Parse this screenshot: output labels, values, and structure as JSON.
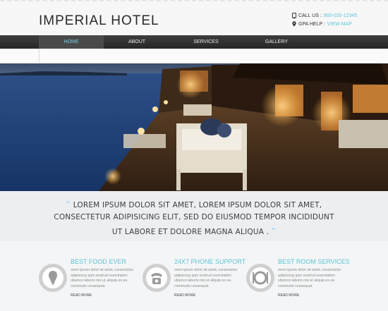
{
  "header": {
    "logo": "IMPERIAL HOTEL",
    "call_label": "CALL US :",
    "call_value": "800-020-12345",
    "gps_label": "GPA HELP :",
    "gps_value": "VIEW MAP"
  },
  "nav": {
    "items": [
      "HOME",
      "ABOUT",
      "SERVICES",
      "GALLERY"
    ],
    "active": "HOME"
  },
  "quote": {
    "open": "“",
    "line1": "LOREM IPSUM DOLOR SIT AMET, LOREM IPSUM DOLOR SIT AMET,",
    "line2": "CONSECTETUR ADIPISICING ELIT, SED DO EIUSMOD TEMPOR INCIDIDUNT",
    "line3": "UT LABORE ET DOLORE MAGNA ALIQUA .",
    "close": "”"
  },
  "features": [
    {
      "title": "BEST FOOD EVER",
      "icon": "ice-cream-icon",
      "text": "orem ipsum dolor sit amet, consectetur adipiscing quis nostrud exercitation ullamco laboris nisi ut aliquip ex ea commodo consequat.",
      "more": "READ MORE"
    },
    {
      "title": "24X7 PHONE SUPPORT",
      "icon": "phone-icon",
      "text": "orem ipsum dolor sit amet, consectetur adipiscing quis nostrud exercitation ullamco laboris nisi ut aliquip ex ea commodo consequat.",
      "more": "READ MORE"
    },
    {
      "title": "BEST ROOM SERVICES",
      "icon": "dining-icon",
      "text": "orem ipsum dolor sit amet, consectetur adipiscing quis nostrud exercitation ullamco laboris nisi ut aliquip ex ea commodo consequat.",
      "more": "READ MORE"
    }
  ],
  "colors": {
    "accent": "#5ec4d8",
    "nav": "#2e2e2e"
  }
}
